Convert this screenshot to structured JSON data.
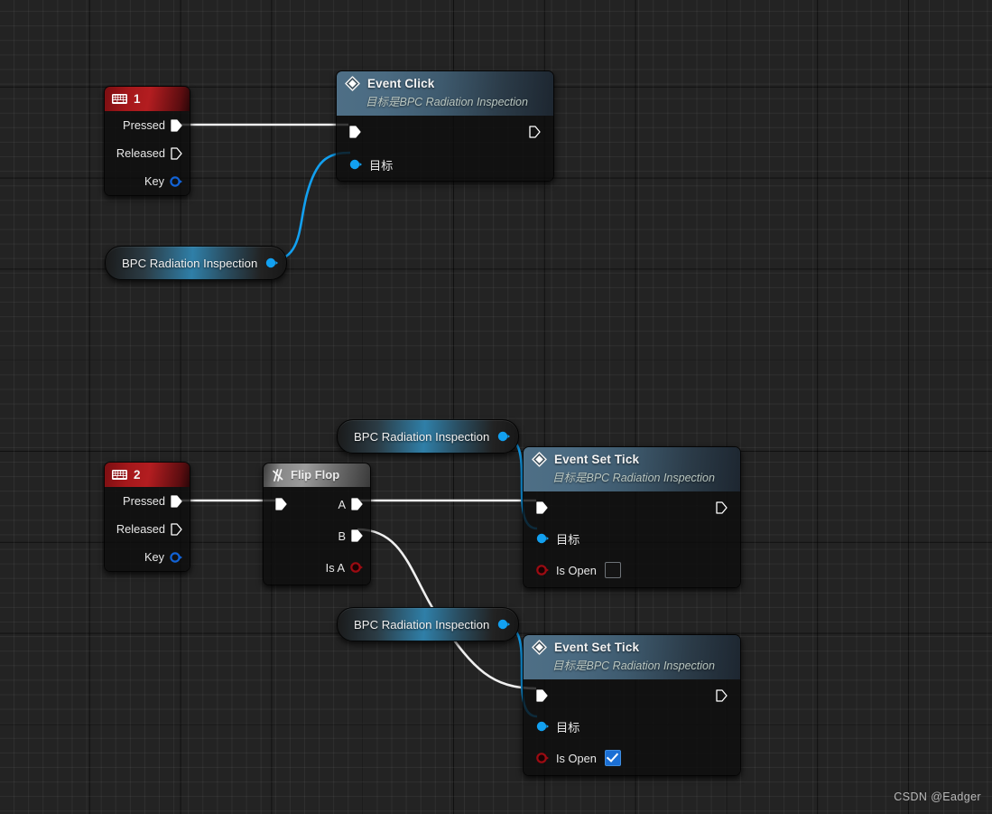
{
  "canvas": {
    "background_color": "#232323",
    "grid_minor_color": "#2e2e2e",
    "grid_major_color": "#151515"
  },
  "watermark": {
    "text": "CSDN @Eadger"
  },
  "palette": {
    "exec_white": "#ffffff",
    "object_blue": "#12a0f0",
    "bool_red": "#9c0b12",
    "event_header": "#4b6b82",
    "key_header": "#a5181b",
    "flipflop_header": "#9b9b9b",
    "checkbox_checked": "#1b6fd4"
  },
  "nodes": {
    "key_1": {
      "title": "1",
      "icon": "keyboard-icon",
      "pins": [
        {
          "label": "Pressed",
          "type": "exec",
          "state": "connected"
        },
        {
          "label": "Released",
          "type": "exec",
          "state": "empty"
        },
        {
          "label": "Key",
          "type": "struct",
          "state": "empty"
        }
      ]
    },
    "key_2": {
      "title": "2",
      "icon": "keyboard-icon",
      "pins": [
        {
          "label": "Pressed",
          "type": "exec",
          "state": "connected"
        },
        {
          "label": "Released",
          "type": "exec",
          "state": "empty"
        },
        {
          "label": "Key",
          "type": "struct",
          "state": "empty"
        }
      ]
    },
    "event_click": {
      "title": "Event Click",
      "subtitle": "目标是BPC Radiation Inspection",
      "icon": "event-diamond-icon",
      "in_exec": "",
      "out_exec": "",
      "target_label": "目标"
    },
    "flip_flop": {
      "title": "Flip Flop",
      "icon": "flipflop-icon",
      "pins": [
        {
          "label": "A",
          "type": "exec",
          "state": "connected"
        },
        {
          "label": "B",
          "type": "exec",
          "state": "connected"
        },
        {
          "label": "Is A",
          "type": "bool",
          "state": "empty"
        }
      ]
    },
    "event_set_tick_a": {
      "title": "Event Set Tick",
      "subtitle": "目标是BPC Radiation Inspection",
      "icon": "event-diamond-icon",
      "target_label": "目标",
      "is_open_label": "Is Open",
      "is_open_checked": false
    },
    "event_set_tick_b": {
      "title": "Event Set Tick",
      "subtitle": "目标是BPC Radiation Inspection",
      "icon": "event-diamond-icon",
      "target_label": "目标",
      "is_open_label": "Is Open",
      "is_open_checked": true
    },
    "self_ref_top": {
      "label": "BPC Radiation Inspection"
    },
    "self_ref_mid": {
      "label": "BPC Radiation Inspection"
    },
    "self_ref_bottom": {
      "label": "BPC Radiation Inspection"
    }
  },
  "connections": [
    {
      "from": "key_1.Pressed",
      "to": "event_click.in_exec",
      "type": "exec"
    },
    {
      "from": "self_ref_top",
      "to": "event_click.target",
      "type": "object"
    },
    {
      "from": "key_2.Pressed",
      "to": "flip_flop.in_exec",
      "type": "exec"
    },
    {
      "from": "flip_flop.A",
      "to": "event_set_tick_a.in_exec",
      "type": "exec"
    },
    {
      "from": "flip_flop.B",
      "to": "event_set_tick_b.in_exec",
      "type": "exec"
    },
    {
      "from": "self_ref_mid",
      "to": "event_set_tick_a.target",
      "type": "object"
    },
    {
      "from": "self_ref_bottom",
      "to": "event_set_tick_b.target",
      "type": "object"
    }
  ]
}
